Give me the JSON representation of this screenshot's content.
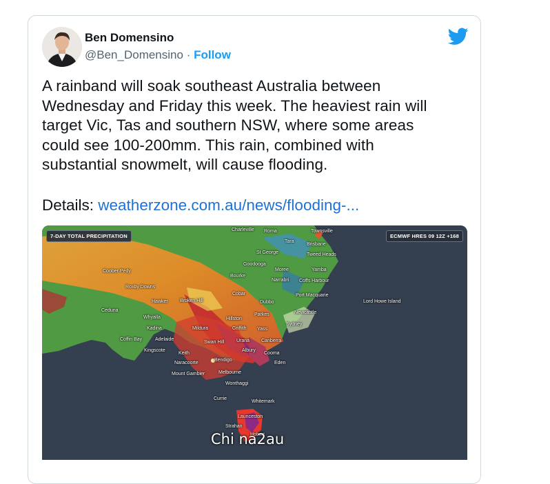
{
  "tweet": {
    "author_name": "Ben Domensino",
    "handle": "@Ben_Domensino",
    "separator": "·",
    "follow_label": "Follow",
    "text": "A rainband will soak southeast Australia between\nWednesday and Friday this week. The heaviest rain will\ntarget Vic, Tas and southern NSW, where some areas\ncould see 100-200mm. This rain, combined with\nsubstantial snowmelt, will cause flooding.",
    "details_label": "Details: ",
    "link_text": "weatherzone.com.au/news/flooding-..."
  },
  "icons": {
    "brand": "twitter-bird-icon",
    "brand_color": "#1d9bf0"
  },
  "map": {
    "left_badge": "7-DAY TOTAL PRECIPITATION",
    "right_badge": "ECMWF HRES 09 12Z +168",
    "places": [
      "Charleville",
      "Roma",
      "Townsville",
      "Tara",
      "Brisbane",
      "St George",
      "Tweed Heads",
      "Goodooga",
      "Moree",
      "Yamba",
      "Narrabri",
      "Coffs Harbour",
      "Bourke",
      "Port Macquarie",
      "Lord Howe Island",
      "Coober Pedy",
      "Roxby Downs",
      "Hawker",
      "Broken Hill",
      "Cobar",
      "Dubbo",
      "Newcastle",
      "Ceduna",
      "Whyalla",
      "Hillston",
      "Parkes",
      "Sydney",
      "Mildura",
      "Griffith",
      "Yass",
      "Kadina",
      "Coffin Bay",
      "Adelaide",
      "Swan Hill",
      "Urana",
      "Canberra",
      "Kingscote",
      "Albury",
      "Cooma",
      "Keith",
      "Bendigo",
      "Eden",
      "Naracoorte",
      "Mount Gambier",
      "Melbourne",
      "Wonthaggi",
      "Currie",
      "Whitemark",
      "Launceston",
      "Strahan",
      "Hobart"
    ]
  },
  "watermark": "Chi na2au",
  "colors": {
    "link": "#1d71d6",
    "follow": "#1d9bf0",
    "map_background": "#343f4f"
  }
}
